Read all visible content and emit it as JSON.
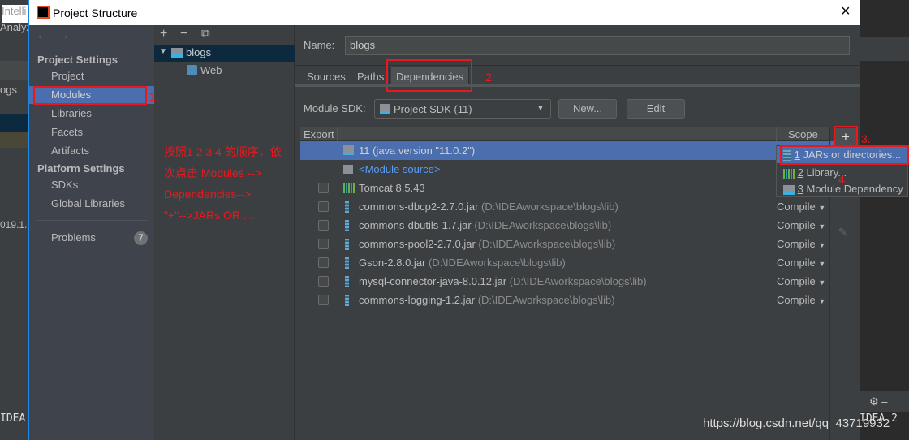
{
  "background_ide": {
    "title_fragment": "Intelli",
    "menu_fragment": "Analyz",
    "project_fragment": "ogs",
    "version_fragment": "019.1.3",
    "bottom_left": "IDEA",
    "bottom_right": "IDEA 2"
  },
  "dialog": {
    "title": "Project Structure",
    "close_icon": "×"
  },
  "sidebar": {
    "project_settings": "Project Settings",
    "platform_settings": "Platform Settings",
    "items": [
      {
        "label": "Project"
      },
      {
        "label": "Modules"
      },
      {
        "label": "Libraries"
      },
      {
        "label": "Facets"
      },
      {
        "label": "Artifacts"
      }
    ],
    "platform_items": [
      {
        "label": "SDKs"
      },
      {
        "label": "Global Libraries"
      }
    ],
    "problems": {
      "label": "Problems",
      "count": "7"
    }
  },
  "tree": {
    "toolbar": {
      "add": "+",
      "remove": "−",
      "copy": "⧉"
    },
    "root": "blogs",
    "child": "Web"
  },
  "annotations": {
    "step1": "1.",
    "step2": "2.",
    "step3": "3.",
    "step4": "4.",
    "note": [
      "按照1 2 3 4 的顺序，依",
      "次点击 Modules -->",
      "Dependencies-->",
      "\"+\"-->JARs OR ..."
    ]
  },
  "main": {
    "name_label": "Name:",
    "name_value": "blogs",
    "tabs": [
      {
        "label": "Sources"
      },
      {
        "label": "Paths"
      },
      {
        "label": "Dependencies",
        "active": true
      }
    ],
    "sdk_label": "Module SDK:",
    "sdk_value": "Project SDK (11)",
    "new_button": "New...",
    "edit_button": "Edit",
    "columns": {
      "export": "Export",
      "scope": "Scope"
    },
    "add_button": "+",
    "sdk_row": "11 (java version \"11.0.2\")",
    "module_source": "<Module source>",
    "tomcat": "Tomcat 8.5.43",
    "deps": [
      {
        "name": "commons-dbcp2-2.7.0.jar",
        "path": "(D:\\IDEAworkspace\\blogs\\lib)",
        "scope": "Compile"
      },
      {
        "name": "commons-dbutils-1.7.jar",
        "path": "(D:\\IDEAworkspace\\blogs\\lib)",
        "scope": "Compile"
      },
      {
        "name": "commons-pool2-2.7.0.jar",
        "path": "(D:\\IDEAworkspace\\blogs\\lib)",
        "scope": "Compile"
      },
      {
        "name": "Gson-2.8.0.jar",
        "path": "(D:\\IDEAworkspace\\blogs\\lib)",
        "scope": "Compile"
      },
      {
        "name": "mysql-connector-java-8.0.12.jar",
        "path": "(D:\\IDEAworkspace\\blogs\\lib)",
        "scope": "Compile"
      },
      {
        "name": "commons-logging-1.2.jar",
        "path": "(D:\\IDEAworkspace\\blogs\\lib)",
        "scope": "Compile"
      }
    ],
    "add_menu": [
      {
        "num": "1",
        "label": "JARs or directories..."
      },
      {
        "num": "2",
        "label": "Library..."
      },
      {
        "num": "3",
        "label": "Module Dependency"
      }
    ]
  },
  "watermark": "https://blog.csdn.net/qq_43719932",
  "colors": {
    "selection": "#4b6eaf",
    "annotation": "#e8191e",
    "link": "#589df6"
  }
}
